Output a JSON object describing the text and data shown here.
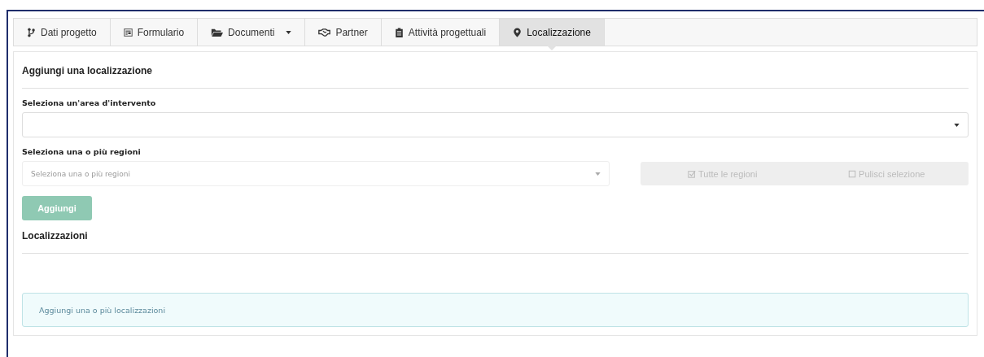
{
  "tabs": [
    {
      "label": "Dati progetto",
      "selected": false,
      "dropdown": false
    },
    {
      "label": "Formulario",
      "selected": false,
      "dropdown": false
    },
    {
      "label": "Documenti",
      "selected": false,
      "dropdown": true
    },
    {
      "label": "Partner",
      "selected": false,
      "dropdown": false
    },
    {
      "label": "Attività progettuali",
      "selected": false,
      "dropdown": false
    },
    {
      "label": "Localizzazione",
      "selected": true,
      "dropdown": false
    }
  ],
  "add_section": {
    "title": "Aggiungi una localizzazione",
    "area_field": {
      "label": "Seleziona un'area d'intervento",
      "disabled": false
    },
    "regions_field": {
      "label": "Seleziona una o più regioni",
      "placeholder": "Seleziona una o più regioni",
      "disabled": true
    },
    "region_buttons": [
      {
        "label": "Tutte le regioni",
        "disabled": true
      },
      {
        "label": "Pulisci selezione",
        "disabled": true
      }
    ],
    "add_button": {
      "label": "Aggiungi",
      "disabled": true
    }
  },
  "list_section": {
    "title": "Localizzazioni",
    "empty_message": "Aggiungi una o più localizzazioni"
  }
}
